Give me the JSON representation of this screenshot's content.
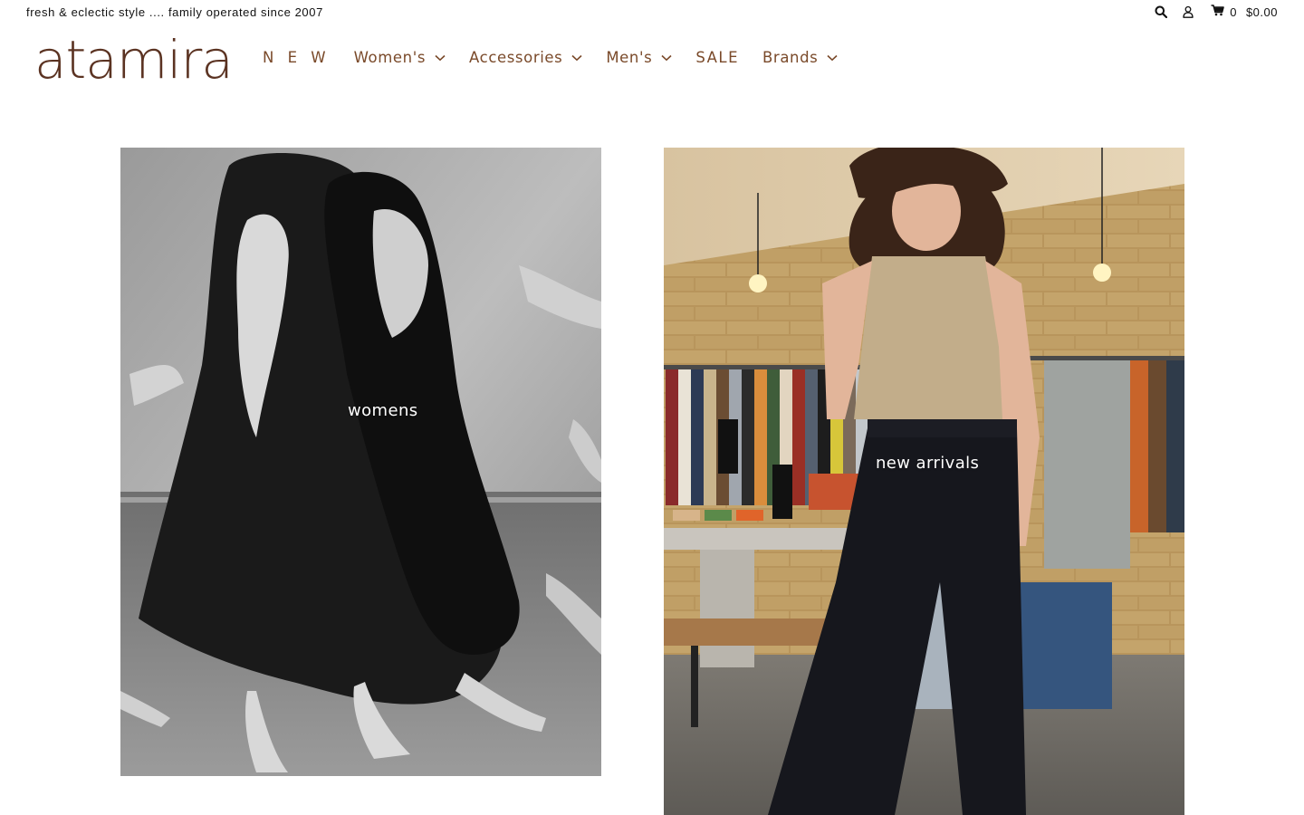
{
  "topbar": {
    "tagline": "fresh & eclectic style .... family operated since 2007",
    "search_icon": "search-icon",
    "account_icon": "user-icon",
    "cart_icon": "cart-icon",
    "cart_count": "0",
    "cart_total": "$0.00"
  },
  "header": {
    "logo": "atamira",
    "nav": [
      {
        "label": "N E W",
        "dropdown": false
      },
      {
        "label": "Women's",
        "dropdown": true
      },
      {
        "label": "Accessories",
        "dropdown": true
      },
      {
        "label": "Men's",
        "dropdown": true
      },
      {
        "label": "SALE",
        "dropdown": false
      },
      {
        "label": "Brands",
        "dropdown": true
      }
    ]
  },
  "tiles": [
    {
      "label": "womens"
    },
    {
      "label": "new arrivals"
    }
  ],
  "colors": {
    "brand": "#5b3322",
    "nav_text": "#7a4a2a",
    "text": "#111111",
    "background": "#ffffff"
  }
}
